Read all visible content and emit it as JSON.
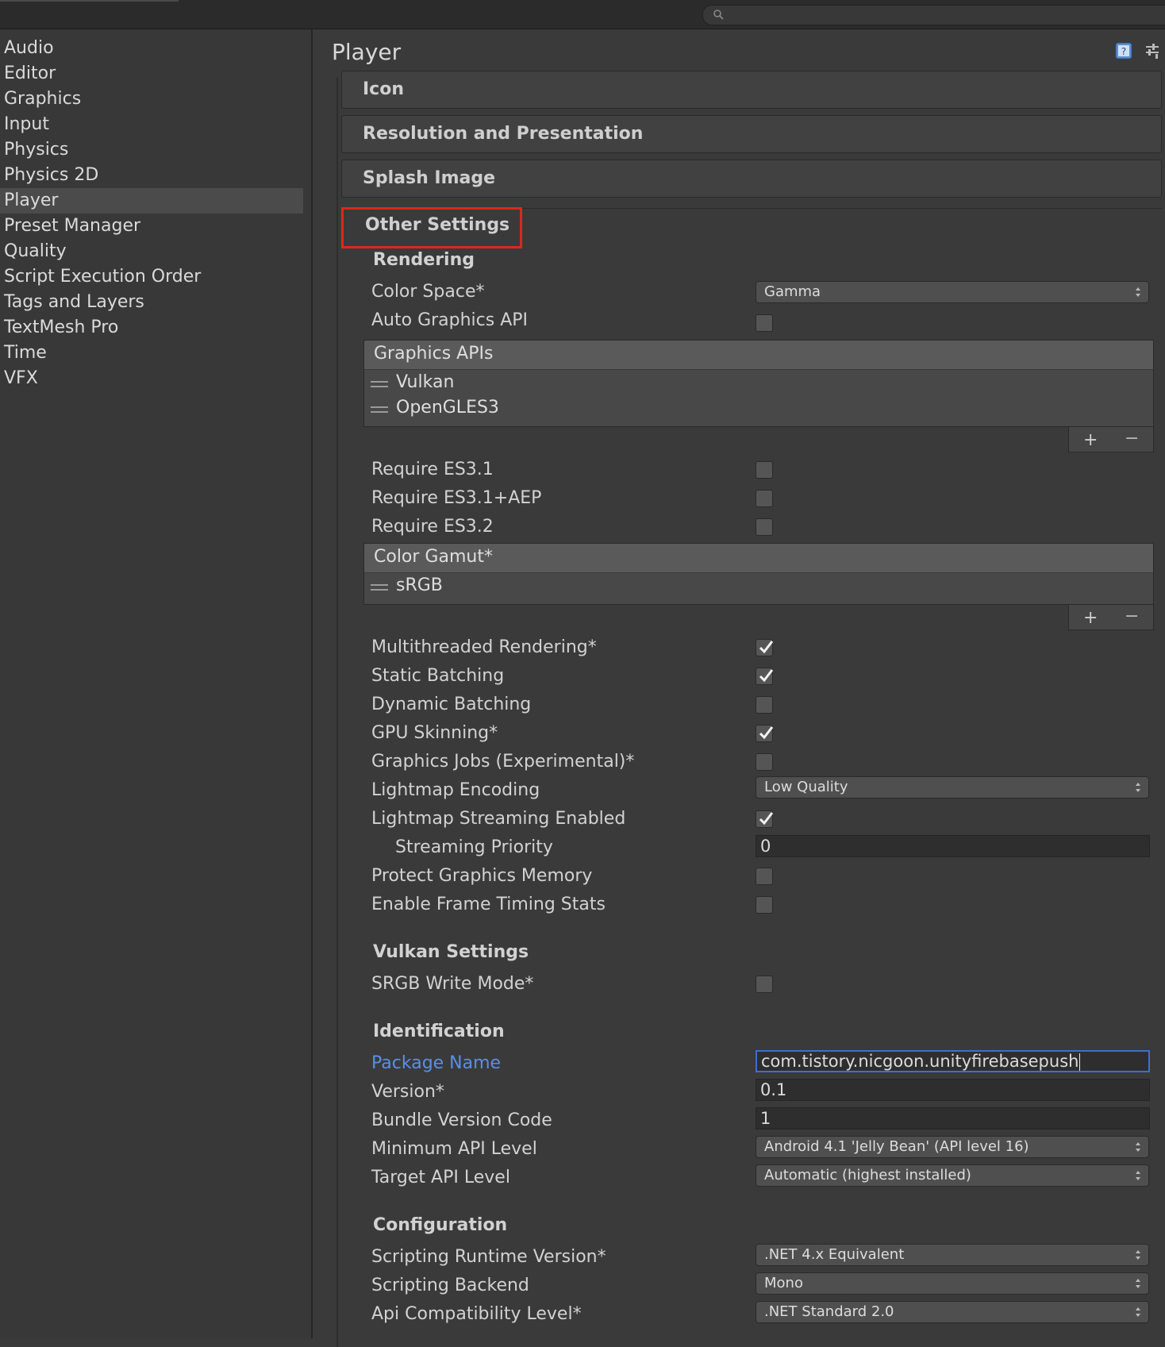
{
  "sidebar": {
    "items": [
      "Audio",
      "Editor",
      "Graphics",
      "Input",
      "Physics",
      "Physics 2D",
      "Player",
      "Preset Manager",
      "Quality",
      "Script Execution Order",
      "Tags and Layers",
      "TextMesh Pro",
      "Time",
      "VFX"
    ],
    "selected": "Player"
  },
  "inspector": {
    "title": "Player",
    "sections": {
      "icon": "Icon",
      "resolution": "Resolution and Presentation",
      "splash": "Splash Image",
      "other": "Other Settings"
    }
  },
  "rendering": {
    "group": "Rendering",
    "color_space": {
      "label": "Color Space*",
      "value": "Gamma"
    },
    "auto_graphics_api": {
      "label": "Auto Graphics API",
      "checked": false
    },
    "graphics_apis": {
      "header": "Graphics APIs",
      "items": [
        "Vulkan",
        "OpenGLES3"
      ]
    },
    "require_es31": {
      "label": "Require ES3.1",
      "checked": false
    },
    "require_es31_aep": {
      "label": "Require ES3.1+AEP",
      "checked": false
    },
    "require_es32": {
      "label": "Require ES3.2",
      "checked": false
    },
    "color_gamut": {
      "header": "Color Gamut*",
      "items": [
        "sRGB"
      ]
    },
    "multithreaded": {
      "label": "Multithreaded Rendering*",
      "checked": true
    },
    "static_batching": {
      "label": "Static Batching",
      "checked": true
    },
    "dynamic_batching": {
      "label": "Dynamic Batching",
      "checked": false
    },
    "gpu_skinning": {
      "label": "GPU Skinning*",
      "checked": true
    },
    "graphics_jobs": {
      "label": "Graphics Jobs (Experimental)*",
      "checked": false
    },
    "lightmap_encoding": {
      "label": "Lightmap Encoding",
      "value": "Low Quality"
    },
    "lightmap_streaming": {
      "label": "Lightmap Streaming Enabled",
      "checked": true
    },
    "streaming_priority": {
      "label": "Streaming Priority",
      "value": "0"
    },
    "protect_memory": {
      "label": "Protect Graphics Memory",
      "checked": false
    },
    "frame_timing": {
      "label": "Enable Frame Timing Stats",
      "checked": false
    }
  },
  "vulkan": {
    "group": "Vulkan Settings",
    "srgb_write": {
      "label": "SRGB Write Mode*",
      "checked": false
    }
  },
  "identification": {
    "group": "Identification",
    "package_name": {
      "label": "Package Name",
      "value": "com.tistory.nicgoon.unityfirebasepush"
    },
    "version": {
      "label": "Version*",
      "value": "0.1"
    },
    "bundle_code": {
      "label": "Bundle Version Code",
      "value": "1"
    },
    "min_api": {
      "label": "Minimum API Level",
      "value": "Android 4.1 'Jelly Bean' (API level 16)"
    },
    "target_api": {
      "label": "Target API Level",
      "value": "Automatic (highest installed)"
    }
  },
  "configuration": {
    "group": "Configuration",
    "runtime": {
      "label": "Scripting Runtime Version*",
      "value": ".NET 4.x Equivalent"
    },
    "backend": {
      "label": "Scripting Backend",
      "value": "Mono"
    },
    "api_compat": {
      "label": "Api Compatibility Level*",
      "value": ".NET Standard 2.0"
    }
  },
  "icons": {
    "search": "search-icon",
    "help": "help-book-icon",
    "presets": "presets-icon",
    "plus": "+",
    "minus": "−"
  },
  "colors": {
    "highlight_box": "#e0261c",
    "active_label": "#5b8fe6",
    "active_field_border": "#3e6ed1"
  }
}
